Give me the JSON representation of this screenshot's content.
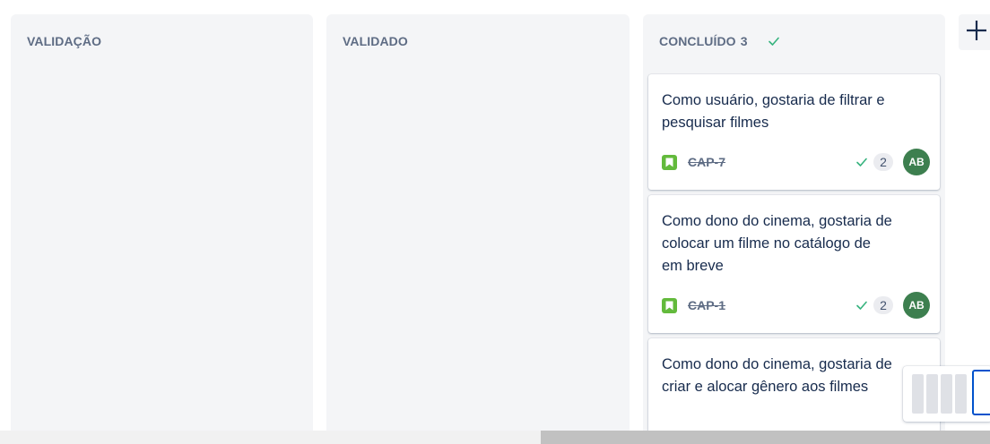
{
  "board": {
    "columns": [
      {
        "title": "VALIDAÇÃO"
      },
      {
        "title": "VALIDADO"
      },
      {
        "title": "CONCLUÍDO",
        "count": "3",
        "cards": [
          {
            "title": "Como usuário, gostaria de filtrar e pesquisar filmes",
            "key": "CAP-7",
            "estimate": "2",
            "assignee": "AB"
          },
          {
            "title": "Como dono do cinema, gostaria de colocar um filme no catálogo de em breve",
            "key": "CAP-1",
            "estimate": "2",
            "assignee": "AB"
          },
          {
            "title": "Como dono do cinema, gostaria de criar e alocar gênero aos filmes"
          }
        ]
      }
    ]
  },
  "icons": {
    "add_column": "plus-icon",
    "done": "check-icon",
    "issue_type": "story-icon"
  },
  "colors": {
    "column_bg": "#f4f5f7",
    "story_green": "#63ba3c",
    "done_check": "#36b37e",
    "avatar_bg": "#3d7f4f",
    "minimap_highlight": "#0052cc"
  }
}
